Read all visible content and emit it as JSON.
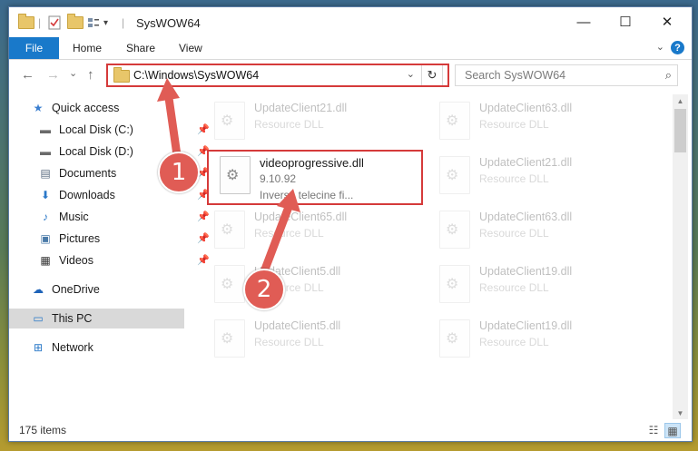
{
  "window": {
    "title": "SysWOW64",
    "qa_separator": "|",
    "qa_dropdown": "▾",
    "minimize": "—",
    "maximize": "☐",
    "close": "✕"
  },
  "ribbon": {
    "tabs": [
      "File",
      "Home",
      "Share",
      "View"
    ],
    "expand": "⌄",
    "help": "?"
  },
  "nav": {
    "back": "←",
    "forward": "→",
    "recent": "⌄",
    "up": "↑",
    "address": "C:\\Windows\\SysWOW64",
    "address_dropdown": "⌄",
    "refresh": "↻",
    "search_placeholder": "Search SysWOW64",
    "search_icon": "⌕"
  },
  "sidebar": {
    "items": [
      {
        "label": "Quick access",
        "icon": "star-icon",
        "glyph": "★",
        "color": "#3b7fd0"
      },
      {
        "label": "Local Disk (C:)",
        "icon": "drive-icon",
        "glyph": "▬",
        "color": "#6a6a6a"
      },
      {
        "label": "Local Disk (D:)",
        "icon": "drive-icon",
        "glyph": "▬",
        "color": "#6a6a6a"
      },
      {
        "label": "Documents",
        "icon": "documents-icon",
        "glyph": "▤",
        "color": "#5a6b80"
      },
      {
        "label": "Downloads",
        "icon": "downloads-icon",
        "glyph": "⬇",
        "color": "#2a78c8"
      },
      {
        "label": "Music",
        "icon": "music-icon",
        "glyph": "♪",
        "color": "#2a78c8"
      },
      {
        "label": "Pictures",
        "icon": "pictures-icon",
        "glyph": "▣",
        "color": "#4a7aa8"
      },
      {
        "label": "Videos",
        "icon": "videos-icon",
        "glyph": "▦",
        "color": "#333333"
      },
      {
        "label": "OneDrive",
        "icon": "cloud-icon",
        "glyph": "☁",
        "color": "#1e63b8"
      },
      {
        "label": "This PC",
        "icon": "computer-icon",
        "glyph": "▭",
        "color": "#2a78c8"
      },
      {
        "label": "Network",
        "icon": "network-icon",
        "glyph": "⊞",
        "color": "#2a78c8"
      }
    ],
    "pin_glyph": "📌"
  },
  "files": {
    "highlighted": {
      "name": "videoprogressive.dll",
      "version": "9.10.92",
      "description": "Inverse telecine fi..."
    },
    "faded": [
      {
        "name": "UpdateClient21.dll",
        "type": "Resource DLL"
      },
      {
        "name": "UpdateClient63.dll",
        "type": "Resource DLL"
      },
      {
        "name": "UpdateClient21.dll",
        "type": "Resource DLL"
      },
      {
        "name": "UpdateClient65.dll",
        "type": "Resource DLL"
      },
      {
        "name": "UpdateClient63.dll",
        "type": "Resource DLL"
      },
      {
        "name": "UpdateClient5.dll",
        "type": "Resource DLL"
      },
      {
        "name": "UpdateClient19.dll",
        "type": "Resource DLL"
      },
      {
        "name": "UpdateClient5.dll",
        "type": "Resource DLL"
      },
      {
        "name": "UpdateClient19.dll",
        "type": "Resource DLL"
      }
    ]
  },
  "status": {
    "item_count": "175 items"
  },
  "annotations": {
    "step1": "1",
    "step2": "2",
    "color": "#d53a3a"
  }
}
